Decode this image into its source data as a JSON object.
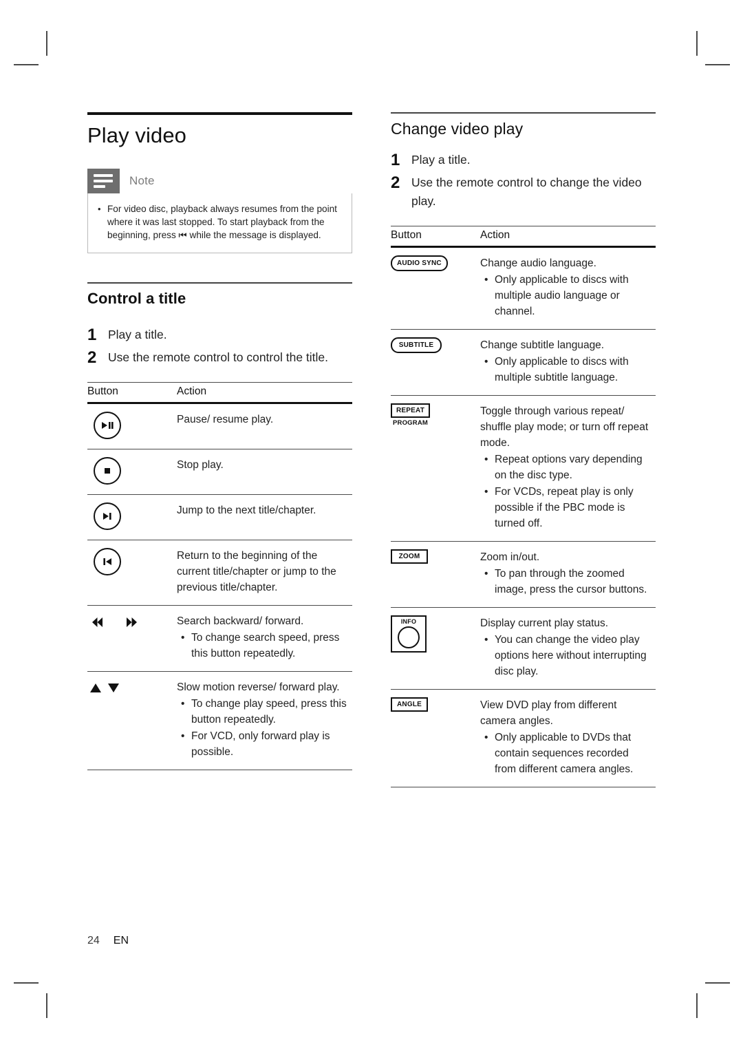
{
  "page": {
    "number": "24",
    "language": "EN"
  },
  "left": {
    "title": "Play video",
    "note": {
      "label": "Note",
      "icon": "note-lines-icon",
      "items": [
        "For video disc, playback always resumes from the point where it was last stopped. To start playback from the beginning, press ⏮ while the message is displayed."
      ]
    },
    "section": {
      "heading": "Control a title",
      "steps": [
        {
          "num": "1",
          "text": "Play a title."
        },
        {
          "num": "2",
          "text": "Use the remote control to control the title."
        }
      ],
      "table": {
        "headers": {
          "button": "Button",
          "action": "Action"
        },
        "rows": [
          {
            "button_icon": "play-pause-button-icon",
            "button_label": "",
            "action": "Pause/ resume play.",
            "bullets": []
          },
          {
            "button_icon": "stop-button-icon",
            "button_label": "",
            "action": "Stop play.",
            "bullets": []
          },
          {
            "button_icon": "next-track-button-icon",
            "button_label": "",
            "action": "Jump to the next title/chapter.",
            "bullets": []
          },
          {
            "button_icon": "previous-track-button-icon",
            "button_label": "",
            "action": "Return to the beginning of the current title/chapter or jump to the previous title/chapter.",
            "bullets": []
          },
          {
            "button_icon": "rewind-fastforward-icon",
            "button_label": "",
            "action": "Search backward/ forward.",
            "bullets": [
              "To change search speed, press this button repeatedly."
            ]
          },
          {
            "button_icon": "up-down-triangles-icon",
            "button_label": "",
            "action": "Slow motion reverse/ forward play.",
            "bullets": [
              "To change play speed, press this button repeatedly.",
              "For VCD, only forward play is possible."
            ]
          }
        ]
      }
    }
  },
  "right": {
    "heading": "Change video play",
    "steps": [
      {
        "num": "1",
        "text": "Play a title."
      },
      {
        "num": "2",
        "text": "Use the remote control to change the video play."
      }
    ],
    "table": {
      "headers": {
        "button": "Button",
        "action": "Action"
      },
      "rows": [
        {
          "button_icon": "audio-sync-key-icon",
          "button_label": "AUDIO SYNC",
          "button_sub": "",
          "action": "Change audio language.",
          "bullets": [
            "Only applicable to discs with multiple audio language or channel."
          ]
        },
        {
          "button_icon": "subtitle-key-icon",
          "button_label": "SUBTITLE",
          "button_sub": "",
          "action": "Change subtitle language.",
          "bullets": [
            "Only applicable to discs with multiple subtitle language."
          ]
        },
        {
          "button_icon": "repeat-program-key-icon",
          "button_label": "REPEAT",
          "button_sub": "PROGRAM",
          "action": "Toggle through various repeat/ shuffle play mode; or turn off repeat mode.",
          "bullets": [
            "Repeat options vary depending on the disc type.",
            "For VCDs, repeat play is only possible if the PBC mode is turned off."
          ]
        },
        {
          "button_icon": "zoom-key-icon",
          "button_label": "ZOOM",
          "button_sub": "",
          "action": "Zoom in/out.",
          "bullets": [
            "To pan through the zoomed image, press the cursor buttons."
          ]
        },
        {
          "button_icon": "info-key-icon",
          "button_label": "INFO",
          "button_sub": "",
          "action": "Display current play status.",
          "bullets": [
            "You can change the video play options here without interrupting disc play."
          ]
        },
        {
          "button_icon": "angle-key-icon",
          "button_label": "ANGLE",
          "button_sub": "",
          "action": "View DVD play from different camera angles.",
          "bullets": [
            "Only applicable to DVDs that contain sequences recorded from different camera angles."
          ]
        }
      ]
    }
  },
  "symbols": {
    "bullet": "•"
  }
}
